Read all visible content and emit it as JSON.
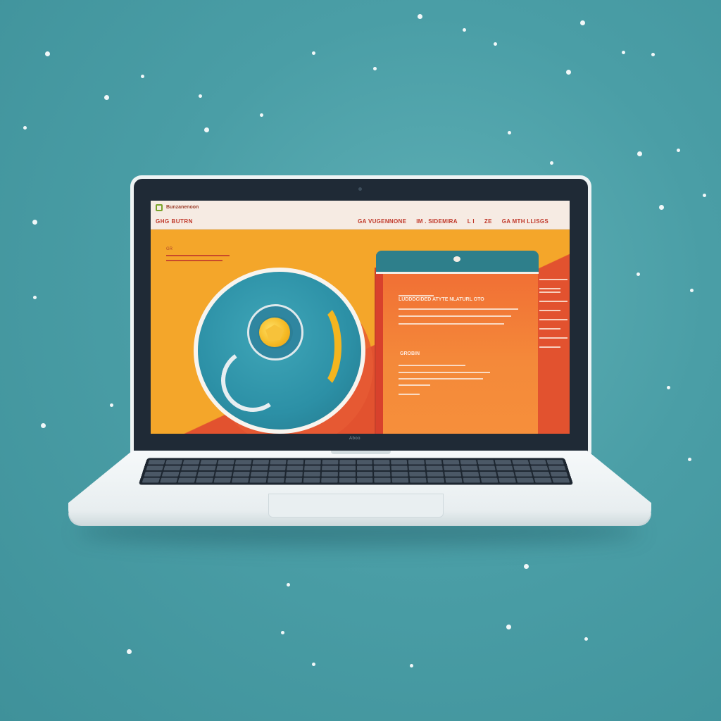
{
  "site": {
    "logo_text": "Bunzanenoon",
    "name": "GHG BUTRN",
    "nav": [
      "GA VUGENNONE",
      "IM . SIDEMIRA",
      "L I",
      "ZE",
      "GA MTH LLISGS"
    ]
  },
  "hero": {
    "eyebrow": "GR",
    "small_text": "GR"
  },
  "card": {
    "title": "LUDDDCIDED ATYTE NLATURL OTO",
    "subtitle": "GROBIN"
  },
  "laptop": {
    "brand": "Aboo"
  },
  "colors": {
    "background": "#4a9ea6",
    "screen_orange": "#f4a62a",
    "accent_red": "#e2522f",
    "accent_teal": "#2c90a6",
    "accent_yellow": "#f4b51f"
  }
}
